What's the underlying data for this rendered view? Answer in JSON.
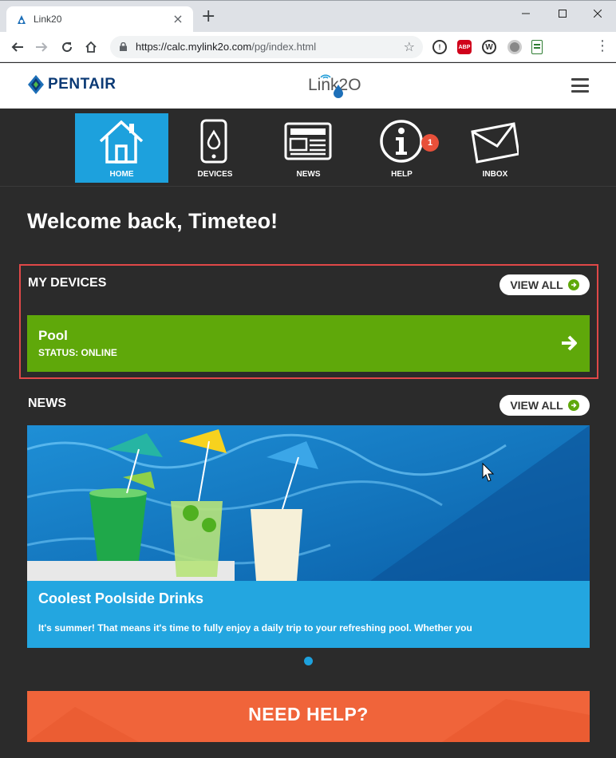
{
  "browser": {
    "tab_title": "Link20",
    "url_host": "https://calc.mylink2o.com",
    "url_path": "/pg/index.html",
    "new_tab_label": "+",
    "extensions": [
      "info",
      "ABP",
      "W",
      "circle",
      "sheet"
    ]
  },
  "header": {
    "brand": "PENTAIR",
    "app_logo": "Link2O"
  },
  "nav": {
    "items": [
      {
        "label": "HOME",
        "icon": "house-icon",
        "active": true
      },
      {
        "label": "DEVICES",
        "icon": "phone-icon",
        "active": false
      },
      {
        "label": "NEWS",
        "icon": "newspaper-icon",
        "active": false
      },
      {
        "label": "HELP",
        "icon": "info-icon",
        "active": false,
        "badge": "1"
      },
      {
        "label": "INBOX",
        "icon": "envelope-icon",
        "active": false
      }
    ]
  },
  "main": {
    "welcome": "Welcome back, Timeteo!",
    "devices": {
      "title": "MY DEVICES",
      "view_all": "VIEW ALL",
      "items": [
        {
          "name": "Pool",
          "status": "STATUS: ONLINE"
        }
      ]
    },
    "news": {
      "title": "NEWS",
      "view_all": "VIEW ALL",
      "article": {
        "title": "Coolest Poolside Drinks",
        "excerpt": "It's summer! That means it's time to fully enjoy a daily trip to your refreshing pool. Whether you"
      }
    },
    "help_banner": "NEED HELP?"
  },
  "colors": {
    "accent_blue": "#1da1dd",
    "device_green": "#5fa80a",
    "help_orange": "#f0643a",
    "badge_red": "#e8503a",
    "highlight_red": "#e04848"
  }
}
